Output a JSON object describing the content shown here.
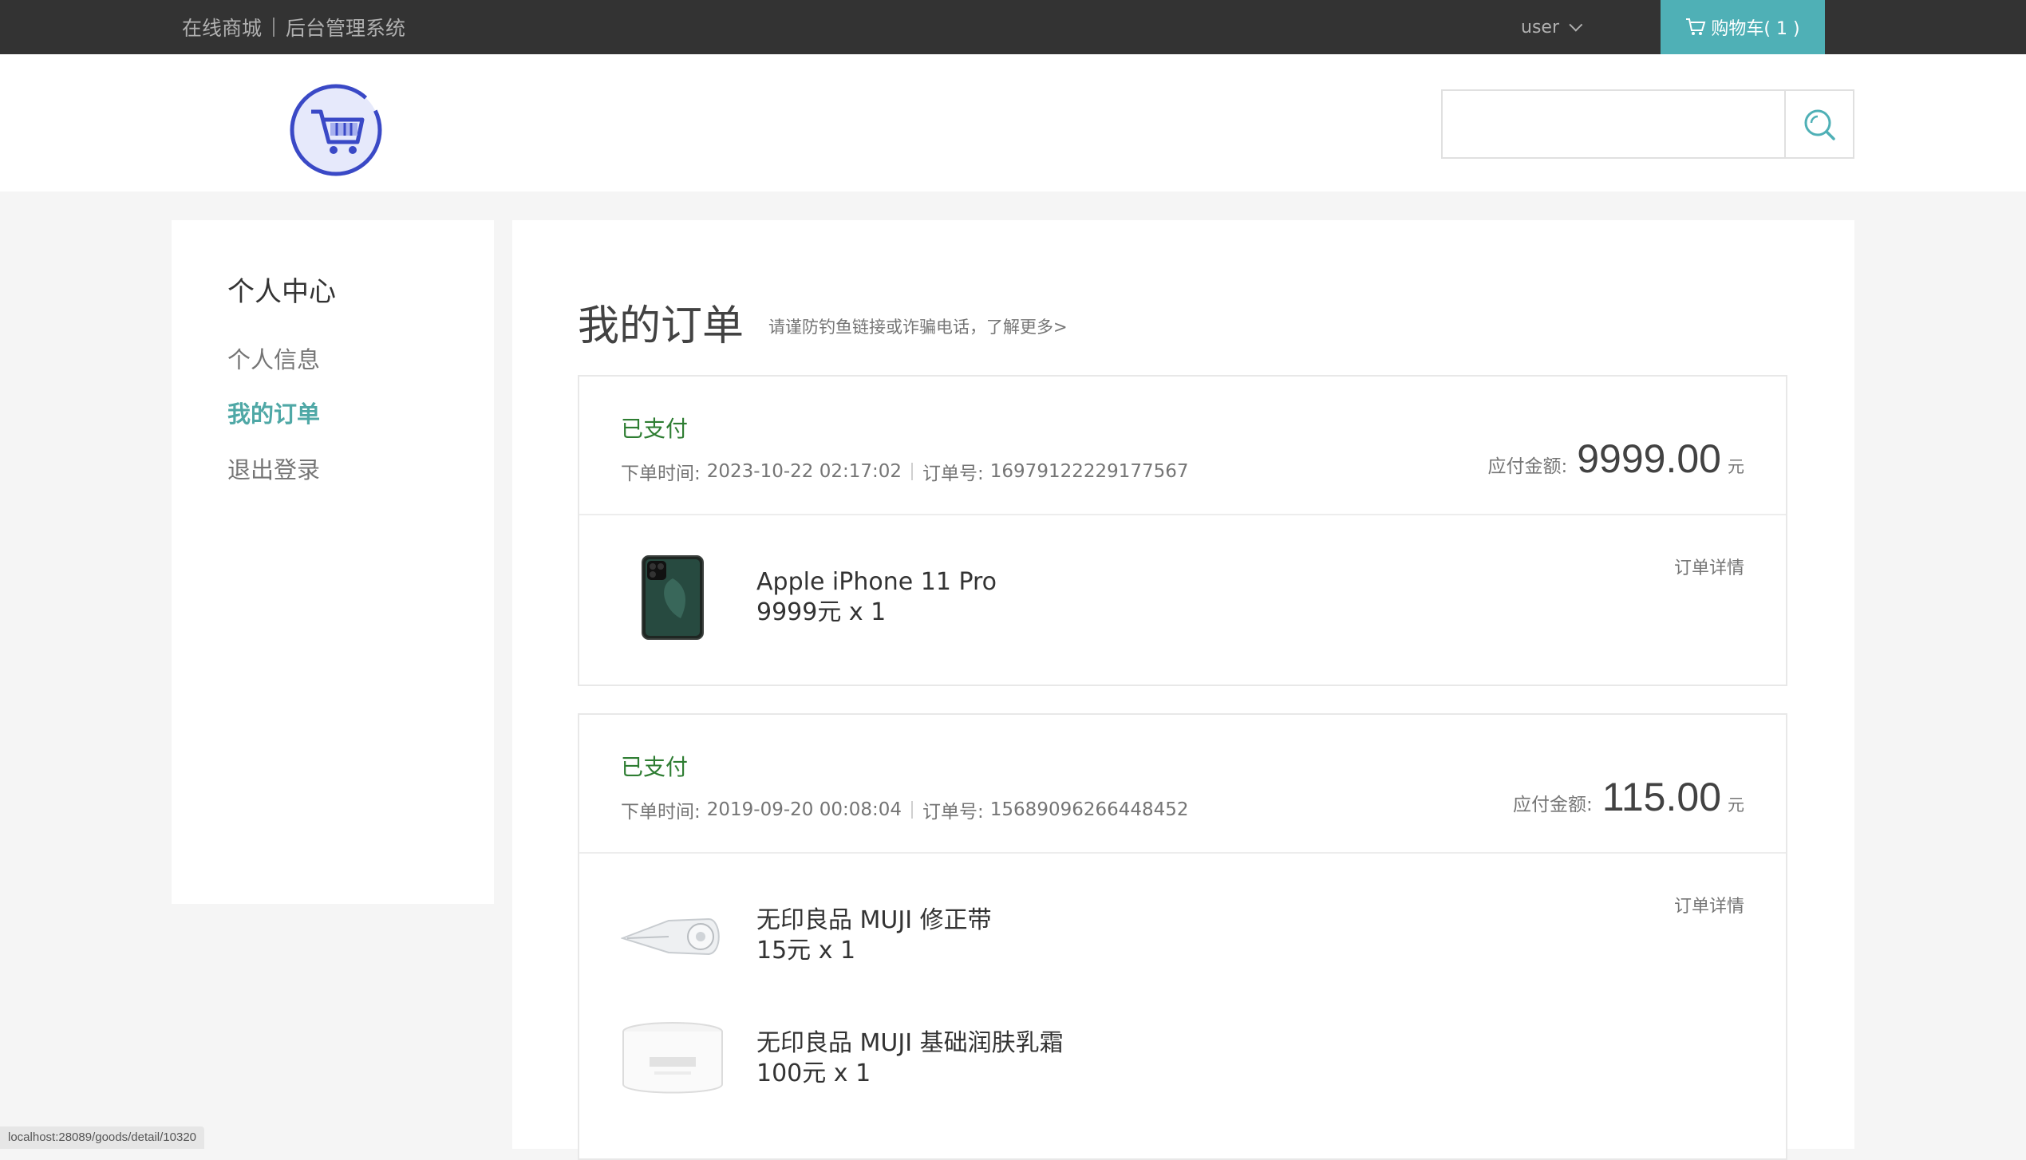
{
  "topbar": {
    "links": [
      "在线商城",
      "后台管理系统"
    ],
    "user": "user",
    "cart_label": "购物车( 1 )"
  },
  "search": {
    "value": "",
    "placeholder": ""
  },
  "sidebar": {
    "title": "个人中心",
    "items": [
      {
        "label": "个人信息",
        "active": false
      },
      {
        "label": "我的订单",
        "active": true
      },
      {
        "label": "退出登录",
        "active": false
      }
    ]
  },
  "main": {
    "title": "我的订单",
    "notice": "请谨防钓鱼链接或诈骗电话，了解更多>",
    "orders": [
      {
        "status": "已支付",
        "time_label": "下单时间:",
        "time": "2023-10-22 02:17:02",
        "no_label": "订单号:",
        "no": "16979122229177567",
        "total_label": "应付金额:",
        "total": "9999.00",
        "unit": "元",
        "detail_label": "订单详情",
        "goods": [
          {
            "name": "Apple iPhone 11 Pro",
            "price": "9999元 x 1",
            "icon": "phone-image"
          }
        ]
      },
      {
        "status": "已支付",
        "time_label": "下单时间:",
        "time": "2019-09-20 00:08:04",
        "no_label": "订单号:",
        "no": "15689096266448452",
        "total_label": "应付金额:",
        "total": "115.00",
        "unit": "元",
        "detail_label": "订单详情",
        "goods": [
          {
            "name": "无印良品 MUJI 修正带",
            "price": "15元 x 1",
            "icon": "correction-tape-image"
          },
          {
            "name": "无印良品 MUJI 基础润肤乳霜",
            "price": "100元 x 1",
            "icon": "cream-jar-image"
          }
        ]
      }
    ]
  },
  "status_url": "localhost:28089/goods/detail/10320",
  "colors": {
    "topbar_bg": "#333333",
    "accent": "#4fb0b6",
    "paid_status": "#2e7d32"
  }
}
